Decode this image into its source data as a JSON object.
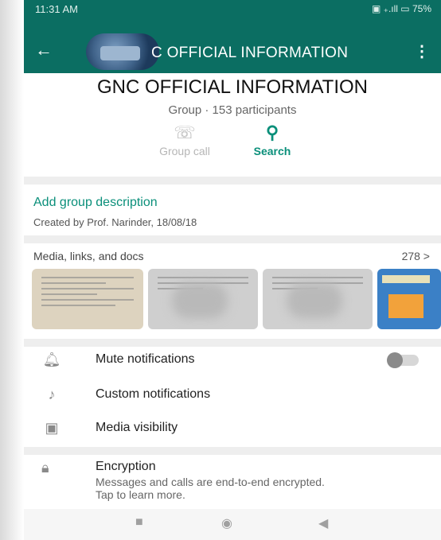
{
  "status_bar": {
    "time": "11:31 AM",
    "indicators": "▣ ₊.ıll ▭ 75%"
  },
  "app_bar": {
    "back_icon": "arrow-left-icon",
    "title": "C OFFICIAL INFORMATION",
    "menu_icon": "more-vertical-icon",
    "accent_color": "#0b6e62"
  },
  "group": {
    "name": "GNC OFFICIAL INFORMATION",
    "subtitle": "Group · 153 participants"
  },
  "actions": [
    {
      "label": "Group call",
      "icon": "add-call-icon"
    },
    {
      "label": "Search",
      "icon": "search-icon"
    }
  ],
  "description": {
    "add_label": "Add group description",
    "created": "Created by Prof. Narinder, 18/08/18"
  },
  "media": {
    "title": "Media, links, and docs",
    "count": "278 >"
  },
  "settings": [
    {
      "label": "Mute notifications",
      "icon": "bell-icon",
      "toggle": false
    },
    {
      "label": "Custom notifications",
      "icon": "music-note-icon"
    },
    {
      "label": "Media visibility",
      "icon": "image-icon"
    }
  ],
  "encryption": {
    "title": "Encryption",
    "text": "Messages and calls are end-to-end encrypted. Tap to learn more.",
    "icon": "lock-icon"
  },
  "nav": {
    "recent_icon": "square-icon",
    "home_icon": "circle-icon",
    "back_icon": "triangle-back-icon"
  }
}
